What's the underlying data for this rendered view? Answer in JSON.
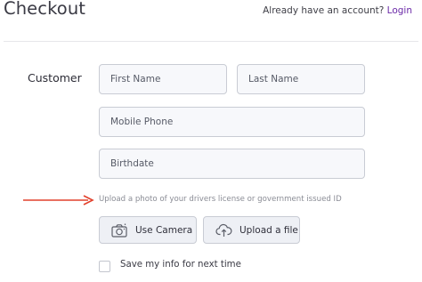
{
  "header": {
    "title": "Checkout",
    "account_prompt": "Already have an account?",
    "login_label": "Login"
  },
  "customer": {
    "section_label": "Customer",
    "first_name_placeholder": "First Name",
    "last_name_placeholder": "Last Name",
    "mobile_placeholder": "Mobile Phone",
    "birthdate_placeholder": "Birthdate"
  },
  "upload": {
    "helper_text": "Upload a photo of your drivers license or government issued ID",
    "camera_label": "Use Camera",
    "upload_label": "Upload a file",
    "camera_icon": "camera-icon",
    "upload_icon": "cloud-upload-icon"
  },
  "save_info": {
    "label": "Save my info for next time",
    "checked": false
  },
  "colors": {
    "accent_link": "#6b2aa8",
    "annotation_arrow": "#e2412c",
    "field_background": "#f7f8fb",
    "button_background": "#eef0f5"
  }
}
